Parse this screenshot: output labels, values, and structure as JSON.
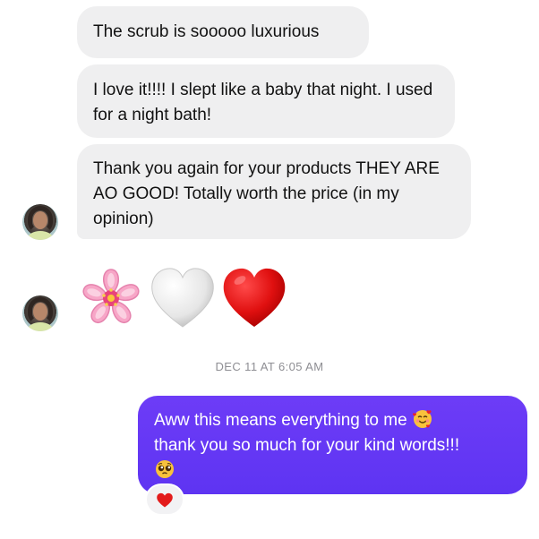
{
  "messages_in": [
    {
      "text": "The scrub is sooooo luxurious"
    },
    {
      "text": "I love it!!!! I slept like a baby that night. I used for a night bath!"
    },
    {
      "text": "Thank you again for your products THEY ARE AO GOOD! Totally worth the price (in my opinion)"
    }
  ],
  "emoji_message": {
    "icons": [
      "cherry-blossom-icon",
      "white-heart-icon",
      "red-heart-icon"
    ]
  },
  "timestamp": "DEC 11 AT 6:05 AM",
  "message_out": {
    "text_line1": "Aww this means everything to me",
    "text_line2": "thank you so much for your kind words!!!",
    "emoji_1": "smiling-face-with-hearts-icon",
    "emoji_2": "pleading-face-icon",
    "color": "#6236f3"
  },
  "reaction": {
    "icon": "red-heart-icon"
  }
}
